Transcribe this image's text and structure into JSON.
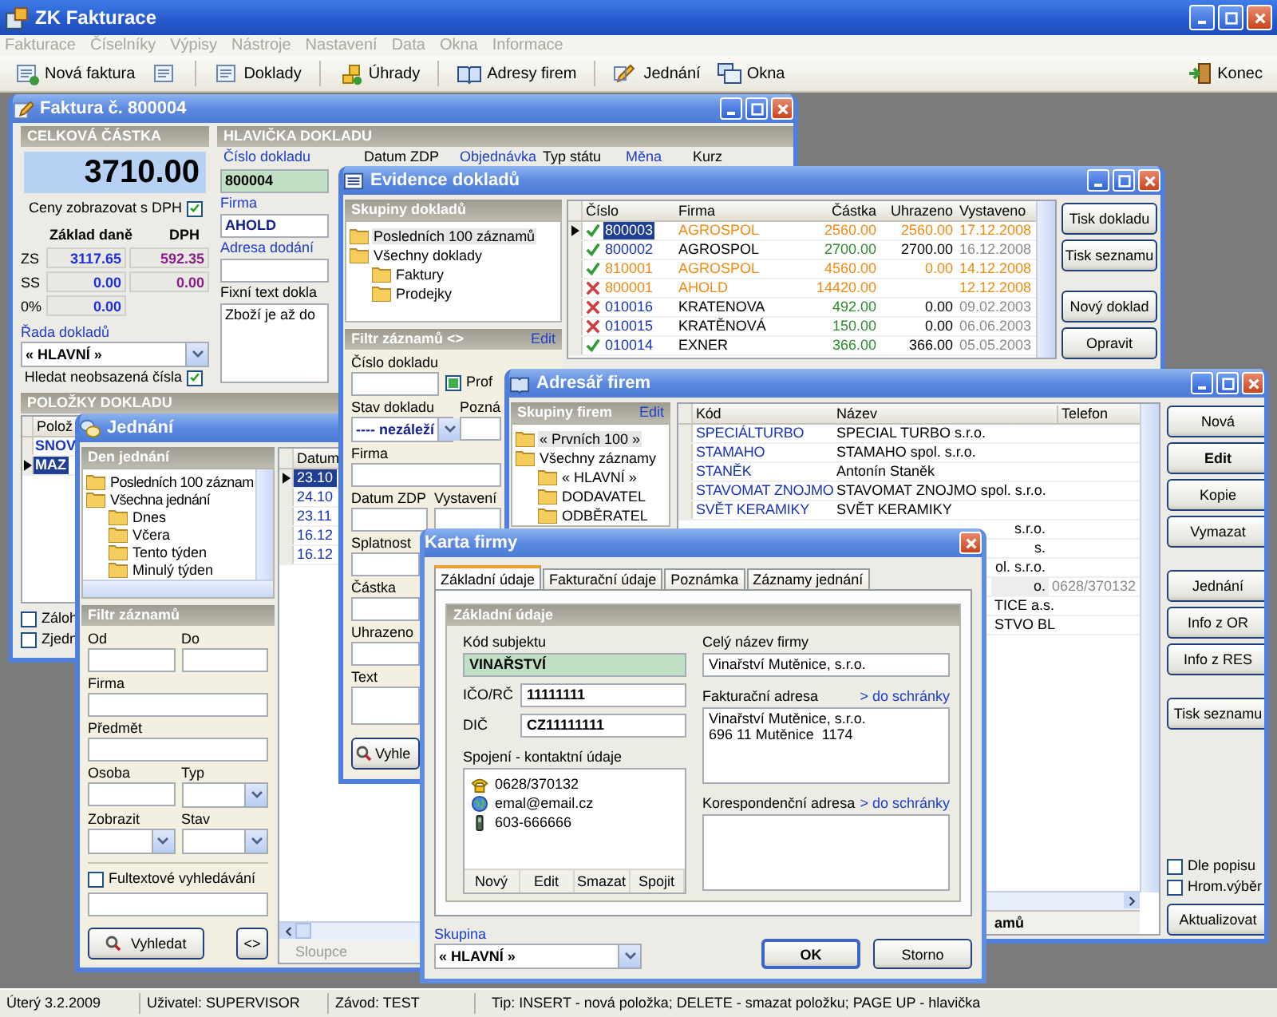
{
  "app": {
    "title": "ZK Fakturace"
  },
  "menu": [
    {
      "label": "Fakturace",
      "disabled": true
    },
    {
      "label": "Číselníky",
      "disabled": true
    },
    {
      "label": "Výpisy",
      "disabled": true
    },
    {
      "label": "Nástroje",
      "disabled": true
    },
    {
      "label": "Nastavení",
      "disabled": true
    },
    {
      "label": "Data",
      "disabled": true
    },
    {
      "label": "Okna",
      "disabled": true
    },
    {
      "label": "Informace",
      "disabled": true
    }
  ],
  "toolbar": [
    {
      "kind": "labeled",
      "label": "Nová faktura"
    },
    {
      "kind": "icon"
    },
    {
      "kind": "labeled",
      "label": "Doklady"
    },
    {
      "kind": "labeled",
      "label": "Úhrady"
    },
    {
      "kind": "labeled",
      "label": "Adresy firem"
    },
    {
      "kind": "labeled",
      "label": "Jednání"
    },
    {
      "kind": "labeled",
      "label": "Okna"
    }
  ],
  "toolbar_right": {
    "label": "Konec"
  },
  "invoice_window": {
    "title": "Faktura č. 800004",
    "total_panel": {
      "header": "CELKOVÁ ČÁSTKA",
      "amount": "3710.00",
      "prices_with_vat": {
        "label": "Ceny zobrazovat s DPH",
        "checked": true
      },
      "columns": [
        "Základ daně",
        "DPH"
      ],
      "rows": [
        {
          "rate": "ZS",
          "base": "3117.65",
          "vat": "592.35"
        },
        {
          "rate": "SS",
          "base": "0.00",
          "vat": "0.00"
        },
        {
          "rate": "0%",
          "base": "0.00"
        }
      ],
      "series_label": "Řada dokladů",
      "series": "« HLAVNÍ »",
      "find_unused": {
        "label": "Hledat neobsazená čísla",
        "checked": true
      }
    },
    "header_panel": {
      "header": "HLAVIČKA DOKLADU",
      "labels": [
        {
          "text": "Číslo dokladu",
          "link": true
        },
        {
          "text": "Datum ZDP",
          "link": false
        },
        {
          "text": "Objednávka",
          "link": true
        },
        {
          "text": "Typ státu",
          "link": false
        },
        {
          "text": "Měna",
          "link": true
        },
        {
          "text": "Kurz",
          "link": false
        }
      ],
      "number": "800004",
      "company_label": "Firma",
      "company": "AHOLD",
      "delivery_label": "Adresa dodání",
      "fixed_text_label": "Fixní text dokla",
      "fixed_text": "Zboží je až do"
    },
    "items_panel": {
      "header": "POLOŽKY DOKLADU",
      "column": "Polož",
      "rows": [
        {
          "text": "SNOV",
          "selected": false
        },
        {
          "text": "MAZ",
          "selected": true
        }
      ]
    },
    "options": [
      {
        "label": "Záloh",
        "checked": false
      },
      {
        "label": "Zjedn",
        "checked": false
      }
    ]
  },
  "meetings_window": {
    "title": "Jednání",
    "days_panel": {
      "header": "Den jednání",
      "items": [
        {
          "label": "Posledních 100 záznam"
        },
        {
          "label": "Všechna jednání",
          "children": [
            {
              "label": "Dnes"
            },
            {
              "label": "Včera"
            },
            {
              "label": "Tento týden"
            },
            {
              "label": "Minulý týden"
            }
          ]
        }
      ]
    },
    "filter": {
      "header": "Filtr záznamů",
      "rows": [
        {
          "fields": [
            {
              "label": "Od",
              "kind": "text"
            },
            {
              "label": "Do",
              "kind": "text"
            }
          ]
        },
        {
          "fields": [
            {
              "label": "Firma",
              "kind": "text"
            }
          ]
        },
        {
          "fields": [
            {
              "label": "Předmět",
              "kind": "text"
            }
          ]
        },
        {
          "fields": [
            {
              "label": "Osoba",
              "kind": "text"
            },
            {
              "label": "Typ",
              "kind": "dropdown"
            }
          ]
        },
        {
          "fields": [
            {
              "label": "Zobrazit",
              "kind": "dropdown"
            },
            {
              "label": "Stav",
              "kind": "dropdown"
            }
          ]
        }
      ],
      "fulltext": {
        "label": "Fultextové vyhledávání",
        "checked": false
      },
      "search_button": "Vyhledat",
      "toggle_button": "<>"
    },
    "grid": {
      "column": "Datum",
      "rows": [
        {
          "date": "23.10",
          "selected": true
        },
        {
          "date": "24.10",
          "selected": false
        },
        {
          "date": "23.11",
          "selected": false
        },
        {
          "date": "16.12",
          "selected": false
        },
        {
          "date": "16.12",
          "selected": false
        }
      ],
      "footer": "Sloupce"
    }
  },
  "documents_window": {
    "title": "Evidence dokladů",
    "groups": {
      "header": "Skupiny dokladů",
      "items": [
        {
          "label": "Posledních 100 záznamů",
          "selected": true
        },
        {
          "label": "Všechny doklady",
          "selected": false,
          "children": [
            {
              "label": "Faktury",
              "selected": false
            },
            {
              "label": "Prodejky",
              "selected": false
            }
          ]
        }
      ]
    },
    "filter": {
      "header": "Filtr záznamů <>",
      "edit": "Edit",
      "rows": [
        {
          "fields": [
            {
              "label": "Číslo dokladu",
              "kind": "text"
            },
            {
              "label": "Prof",
              "kind": "checkbox",
              "checked": true
            }
          ]
        },
        {
          "fields": [
            {
              "label": "Stav dokladu",
              "kind": "dropdown",
              "value": "---- nezáleží"
            },
            {
              "label": "Pozná",
              "kind": "text"
            }
          ]
        },
        {
          "fields": [
            {
              "label": "Firma",
              "kind": "text"
            }
          ]
        },
        {
          "fields": [
            {
              "label": "Datum ZDP",
              "kind": "text"
            },
            {
              "label": "Vystavení",
              "kind": "text"
            }
          ]
        },
        {
          "fields": [
            {
              "label": "Splatnost",
              "kind": "text"
            }
          ]
        },
        {
          "fields": [
            {
              "label": "Částka",
              "kind": "text"
            }
          ]
        },
        {
          "fields": [
            {
              "label": "Uhrazeno",
              "kind": "text"
            }
          ]
        },
        {
          "fields": [
            {
              "label": "Text",
              "kind": "textarea"
            }
          ]
        }
      ],
      "search_button": "Vyhle"
    },
    "grid": {
      "columns": [
        "Číslo",
        "Firma",
        "Částka",
        "Uhrazeno",
        "Vystaveno"
      ],
      "rows": [
        {
          "number": "800003",
          "firm": "AGROSPOL",
          "amount": "2560.00",
          "paid": "2560.00",
          "issued": "17.12.2008",
          "cancelled": false,
          "highlighted": true,
          "selected": true
        },
        {
          "number": "800002",
          "firm": "AGROSPOL",
          "amount": "2700.00",
          "paid": "2700.00",
          "issued": "16.12.2008",
          "cancelled": false,
          "highlighted": false,
          "selected": false
        },
        {
          "number": "810001",
          "firm": "AGROSPOL",
          "amount": "4560.00",
          "paid": "0.00",
          "issued": "14.12.2008",
          "cancelled": false,
          "highlighted": true,
          "selected": false
        },
        {
          "number": "800001",
          "firm": "AHOLD",
          "amount": "14420.00",
          "issued": "12.12.2008",
          "cancelled": true,
          "highlighted": true,
          "selected": false
        },
        {
          "number": "010016",
          "firm": "KRATENOVA",
          "amount": "492.00",
          "paid": "0.00",
          "issued": "09.02.2003",
          "cancelled": true,
          "highlighted": false,
          "selected": false
        },
        {
          "number": "010015",
          "firm": "KRATĚNOVÁ",
          "amount": "150.00",
          "paid": "0.00",
          "issued": "06.06.2003",
          "cancelled": true,
          "highlighted": false,
          "selected": false
        },
        {
          "number": "010014",
          "firm": "EXNER",
          "amount": "366.00",
          "paid": "366.00",
          "issued": "05.05.2003",
          "cancelled": false,
          "highlighted": false,
          "selected": false
        }
      ]
    },
    "button_groups": [
      [
        "Tisk dokladu",
        "Tisk seznamu"
      ],
      [
        "Nový doklad",
        "Opravit"
      ]
    ]
  },
  "companies_window": {
    "title": "Adresář firem",
    "groups": {
      "header": "Skupiny firem",
      "edit": "Edit",
      "items": [
        {
          "label": "« Prvních 100 »",
          "selected": true
        },
        {
          "label": "Všechny záznamy",
          "selected": false,
          "children": [
            {
              "label": "« HLAVNÍ »",
              "selected": false
            },
            {
              "label": "DODAVATEL",
              "selected": false
            },
            {
              "label": "ODBĚRATEL",
              "selected": false
            }
          ]
        }
      ]
    },
    "grid": {
      "columns": [
        "Kód",
        "Název",
        "Telefon"
      ],
      "rows": [
        {
          "kind": "full",
          "code": "SPECIÁLTURBO",
          "name": "SPECIAL TURBO s.r.o.",
          "selected": false
        },
        {
          "kind": "full",
          "code": "STAMAHO",
          "name": "STAMAHO spol. s.r.o.",
          "selected": false
        },
        {
          "kind": "full",
          "code": "STANĚK",
          "name": "Antonín Staněk",
          "selected": false
        },
        {
          "kind": "full",
          "code": "STAVOMAT ZNOJMO",
          "name": "STAVOMAT ZNOJMO spol. s.r.o.",
          "selected": false
        },
        {
          "kind": "full",
          "code": "SVĚT KERAMIKY",
          "name": "SVĚT KERAMIKY",
          "selected": false
        },
        {
          "kind": "partial",
          "name": "s.r.o.",
          "selected": false
        },
        {
          "kind": "partial",
          "name": "s.",
          "selected": false
        },
        {
          "kind": "partial",
          "name": "ol. s.r.o.",
          "selected": false
        },
        {
          "kind": "partial",
          "name": "o.",
          "phone": "0628/370132",
          "selected": true
        },
        {
          "kind": "partial",
          "name": "TICE a.s.",
          "selected": false
        },
        {
          "kind": "partial",
          "name": "STVO BL",
          "selected": false
        }
      ],
      "footer": "amů"
    },
    "button_groups": [
      [
        {
          "label": "Nová",
          "default": false
        },
        {
          "label": "Edit",
          "default": true
        },
        {
          "label": "Kopie",
          "default": false
        },
        {
          "label": "Vymazat",
          "default": false
        }
      ],
      [
        {
          "label": "Jednání",
          "default": false
        },
        {
          "label": "Info z OR",
          "default": false
        },
        {
          "label": "Info z RES",
          "default": false
        }
      ],
      [
        {
          "label": "Tisk seznamu",
          "default": false
        }
      ]
    ],
    "options": [
      {
        "label": "Dle popisu",
        "checked": false
      },
      {
        "label": "Hrom.výběr",
        "checked": false
      }
    ],
    "refresh_button": "Aktualizovat"
  },
  "company_card": {
    "title": "Karta firmy",
    "tabs": [
      {
        "label": "Základní údaje",
        "selected": true
      },
      {
        "label": "Fakturační údaje",
        "selected": false
      },
      {
        "label": "Poznámka",
        "selected": false
      },
      {
        "label": "Záznamy jednání",
        "selected": false
      }
    ],
    "group_header": "Základní údaje",
    "code_label": "Kód subjektu",
    "code": "VINAŘSTVÍ",
    "ids": [
      {
        "label": "IČO/RČ",
        "value": "11111111"
      },
      {
        "label": "DIČ",
        "value": "CZ11111111"
      }
    ],
    "contacts": {
      "label": "Spojení - kontaktní údaje",
      "items": [
        {
          "kind": "phone",
          "text": "0628/370132"
        },
        {
          "kind": "email",
          "text": "emal@email.cz"
        },
        {
          "kind": "mobile",
          "text": "603-666666"
        }
      ],
      "actions": [
        "Nový",
        "Edit",
        "Smazat",
        "Spojit"
      ]
    },
    "full_name": {
      "label": "Celý název firmy",
      "value": "Vinařství Mutěnice, s.r.o."
    },
    "billing": {
      "label": "Fakturační adresa",
      "link": "> do schránky",
      "lines": [
        "Vinařství Mutěnice, s.r.o.",
        "696 11 Mutěnice  1174"
      ]
    },
    "mailing": {
      "label": "Korespondenční adresa",
      "link": "> do schránky"
    },
    "group_label": "Skupina",
    "group": "« HLAVNÍ »",
    "buttons": [
      {
        "label": "OK",
        "default": true
      },
      {
        "label": "Storno",
        "default": false
      }
    ]
  },
  "status_bar": [
    "Úterý 3.2.2009",
    "Uživatel: SUPERVISOR",
    "Závod: TEST",
    "Tip: INSERT - nová položka; DELETE - smazat položku; PAGE UP - hlavička"
  ]
}
